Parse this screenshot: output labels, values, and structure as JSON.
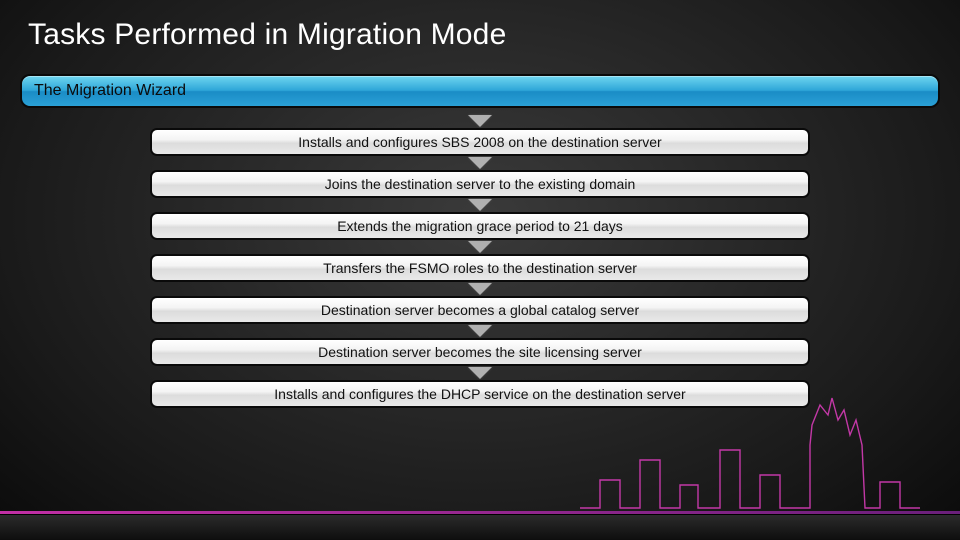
{
  "title": "Tasks Performed in Migration Mode",
  "header": "The Migration Wizard",
  "steps": [
    "Installs and configures SBS 2008 on the destination server",
    "Joins the destination server to the existing domain",
    "Extends the migration grace period to 21 days",
    "Transfers the FSMO roles to the destination server",
    "Destination server becomes a global catalog server",
    "Destination server becomes the site licensing server",
    "Installs and configures the DHCP service on the destination server"
  ]
}
